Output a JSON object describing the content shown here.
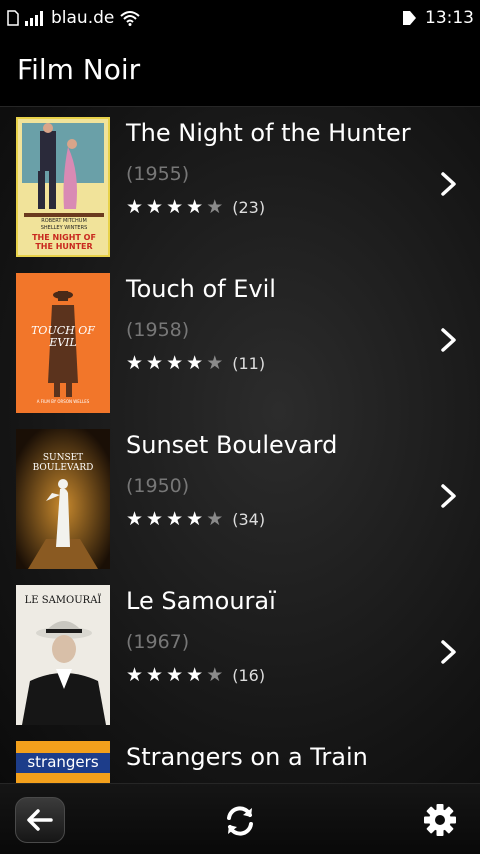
{
  "status_bar": {
    "carrier": "blau.de",
    "time": "13:13",
    "icons": [
      "sim-icon",
      "signal-icon",
      "wifi-icon",
      "notification-icon"
    ]
  },
  "header": {
    "title": "Film Noir"
  },
  "movies": [
    {
      "title": "The Night of the Hunter",
      "year": "(1955)",
      "rating": 4,
      "count": "(23)",
      "poster_text": [
        "ROBERT MITCHUM",
        "SHELLEY WINTERS",
        "THE NIGHT OF THE HUNTER"
      ]
    },
    {
      "title": "Touch of Evil",
      "year": "(1958)",
      "rating": 4,
      "count": "(11)",
      "poster_text": [
        "TOUCH OF EVIL",
        "A FILM BY ORSON WELLES"
      ]
    },
    {
      "title": "Sunset Boulevard",
      "year": "(1950)",
      "rating": 4,
      "count": "(34)",
      "poster_text": [
        "SUNSET",
        "BOULEVARD"
      ]
    },
    {
      "title": "Le Samouraï",
      "year": "(1967)",
      "rating": 4,
      "count": "(16)",
      "poster_text": [
        "LE SAMOURAÏ"
      ]
    },
    {
      "title": "Strangers on a Train",
      "year": "",
      "rating": 0,
      "count": "",
      "poster_text": [
        "strangers"
      ]
    }
  ],
  "toolbar": {
    "icons": [
      "back-arrow-icon",
      "refresh-icon",
      "gear-icon"
    ]
  },
  "colors": {
    "background": "#000000",
    "year_text": "#777777",
    "star_on": "#ffffff",
    "star_off": "#8a8a8a"
  }
}
